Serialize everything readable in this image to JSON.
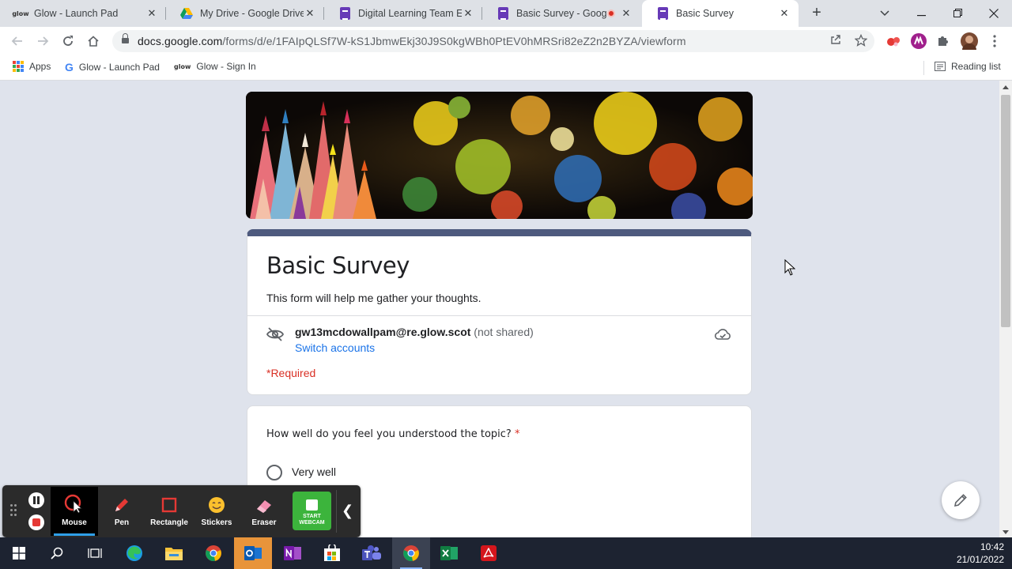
{
  "browser": {
    "tabs": [
      {
        "title": "Glow - Launch Pad",
        "favicon": "glow-icon",
        "favicon_text": "glow",
        "close": "✕"
      },
      {
        "title": "My Drive - Google Drive",
        "favicon": "google-drive-icon",
        "close": "✕"
      },
      {
        "title": "Digital Learning Team Eve",
        "favicon": "google-forms-icon",
        "close": "✕"
      },
      {
        "title": "Basic Survey - Googl",
        "favicon": "google-forms-icon",
        "close": "✕",
        "recording": true
      },
      {
        "title": "Basic Survey",
        "favicon": "google-forms-icon",
        "close": "✕",
        "active": true
      }
    ],
    "new_tab": "+",
    "url_domain": "docs.google.com",
    "url_path": "/forms/d/e/1FAIpQLSf7W-kS1JbmwEkj30J9S0kgWBh0PtEV0hMRSri82eZ2n2BYZA/viewform",
    "bookmarks": [
      {
        "label": "Apps",
        "icon": "apps-grid-icon"
      },
      {
        "label": "Glow - Launch Pad",
        "icon": "google-icon",
        "icon_text": "G"
      },
      {
        "label": "Glow - Sign In",
        "icon": "glow-icon",
        "icon_text": "glow"
      }
    ],
    "reading_list": "Reading list"
  },
  "form": {
    "title": "Basic Survey",
    "description": "This form will help me gather your thoughts.",
    "account_email": "gw13mcdowallpam@re.glow.scot",
    "account_note": " (not shared)",
    "switch_accounts": "Switch accounts",
    "required_note": "*Required",
    "question": "How well do you feel you understood the topic?",
    "required_star": " *",
    "options": [
      "Very well"
    ]
  },
  "recorder": {
    "tools": [
      {
        "label": "Mouse",
        "icon": "mouse-cursor-icon",
        "selected": true
      },
      {
        "label": "Pen",
        "icon": "pen-icon"
      },
      {
        "label": "Rectangle",
        "icon": "rectangle-icon"
      },
      {
        "label": "Stickers",
        "icon": "sticker-smiley-icon"
      },
      {
        "label": "Eraser",
        "icon": "eraser-icon"
      }
    ],
    "webcam_line1": "START",
    "webcam_line2": "WEBCAM",
    "collapse": "❮"
  },
  "taskbar": {
    "time": "10:42",
    "date": "21/01/2022"
  },
  "colors": {
    "form_accent": "#4e5a7e",
    "required_red": "#d93025",
    "link_blue": "#1a73e8",
    "forms_purple": "#673ab7",
    "recorder_selected_underline": "#2f9fe8",
    "webcam_green": "#3cb43c"
  }
}
